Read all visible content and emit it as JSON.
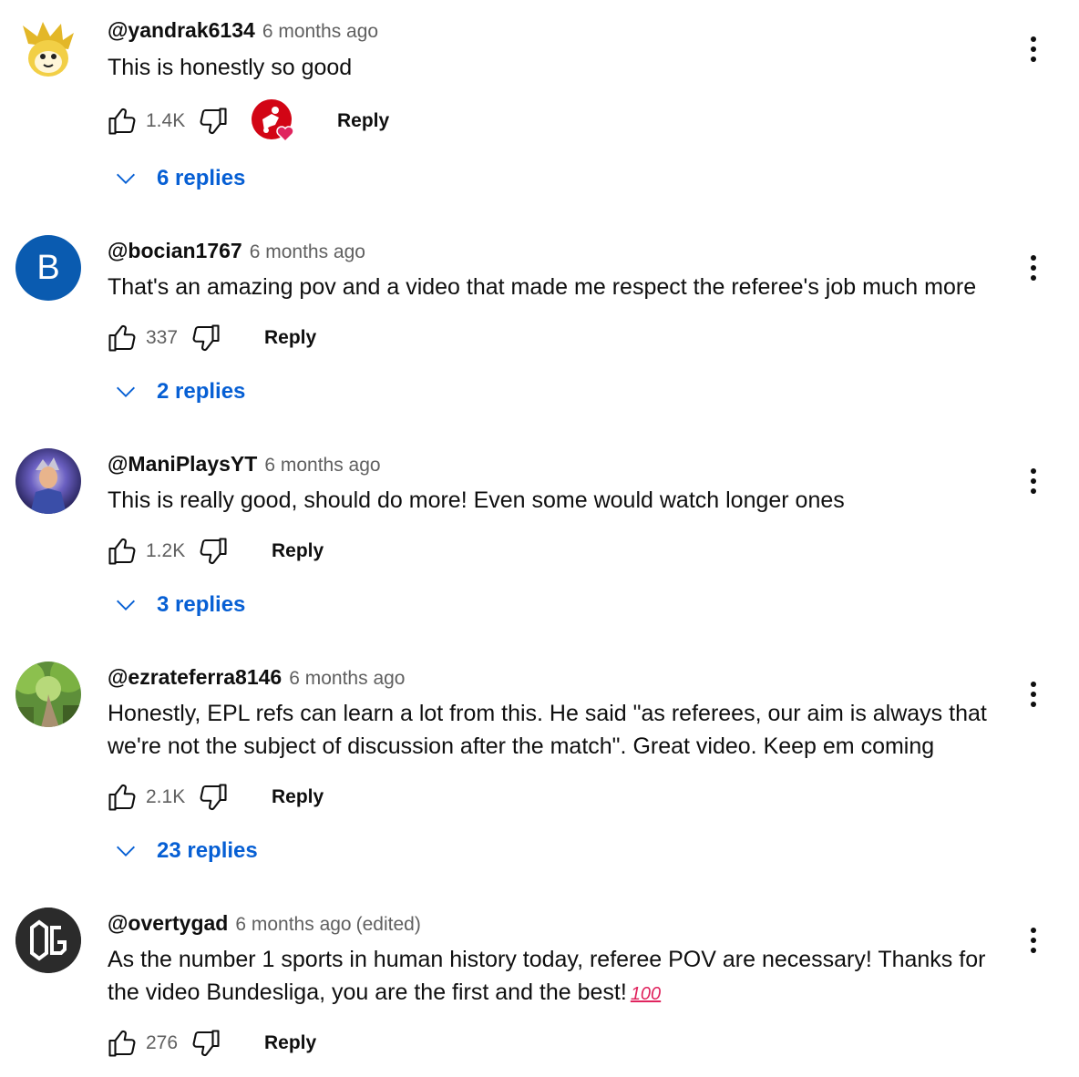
{
  "comments": [
    {
      "author": "@yandrak6134",
      "time": "6 months ago",
      "edited": "",
      "text": "This is honestly so good",
      "likes": "1.4K",
      "reply_label": "Reply",
      "replies_label": "6 replies",
      "creator_heart": true,
      "avatar_letter": ""
    },
    {
      "author": "@bocian1767",
      "time": "6 months ago",
      "edited": "",
      "text": "That's an amazing pov and a video that made me respect the referee's job much more",
      "likes": "337",
      "reply_label": "Reply",
      "replies_label": "2 replies",
      "creator_heart": false,
      "avatar_letter": "B"
    },
    {
      "author": "@ManiPlaysYT",
      "time": "6 months ago",
      "edited": "",
      "text": "This is really good, should do more! Even some would watch longer ones",
      "likes": "1.2K",
      "reply_label": "Reply",
      "replies_label": "3 replies",
      "creator_heart": false,
      "avatar_letter": ""
    },
    {
      "author": "@ezrateferra8146",
      "time": "6 months ago",
      "edited": "",
      "text_lines": [
        "Honestly, EPL refs can learn a lot from this. He said \"as referees, our aim is always that",
        "we're not the subject of discussion after the match\". Great video. Keep em coming"
      ],
      "likes": "2.1K",
      "reply_label": "Reply",
      "replies_label": "23 replies",
      "creator_heart": false,
      "avatar_letter": ""
    },
    {
      "author": "@overtygad",
      "time": "6 months ago",
      "edited": "(edited)",
      "text_lines": [
        "As the number 1 sports in human history today, referee POV are necessary! Thanks for",
        "the video Bundesliga, you are the first and the best!"
      ],
      "emoji": "100",
      "likes": "276",
      "reply_label": "Reply",
      "replies_label": "",
      "creator_heart": false,
      "avatar_letter": "OG"
    }
  ],
  "colors": {
    "link_blue": "#065fd4",
    "secondary_text": "#606060",
    "avatar_b_bg": "#0a5bb0",
    "bundesliga_red": "#d20515"
  },
  "icons": {
    "like": "thumbs-up-icon",
    "dislike": "thumbs-down-icon",
    "menu": "more-vert-icon",
    "expand": "chevron-down-icon",
    "heart": "creator-heart-icon"
  }
}
